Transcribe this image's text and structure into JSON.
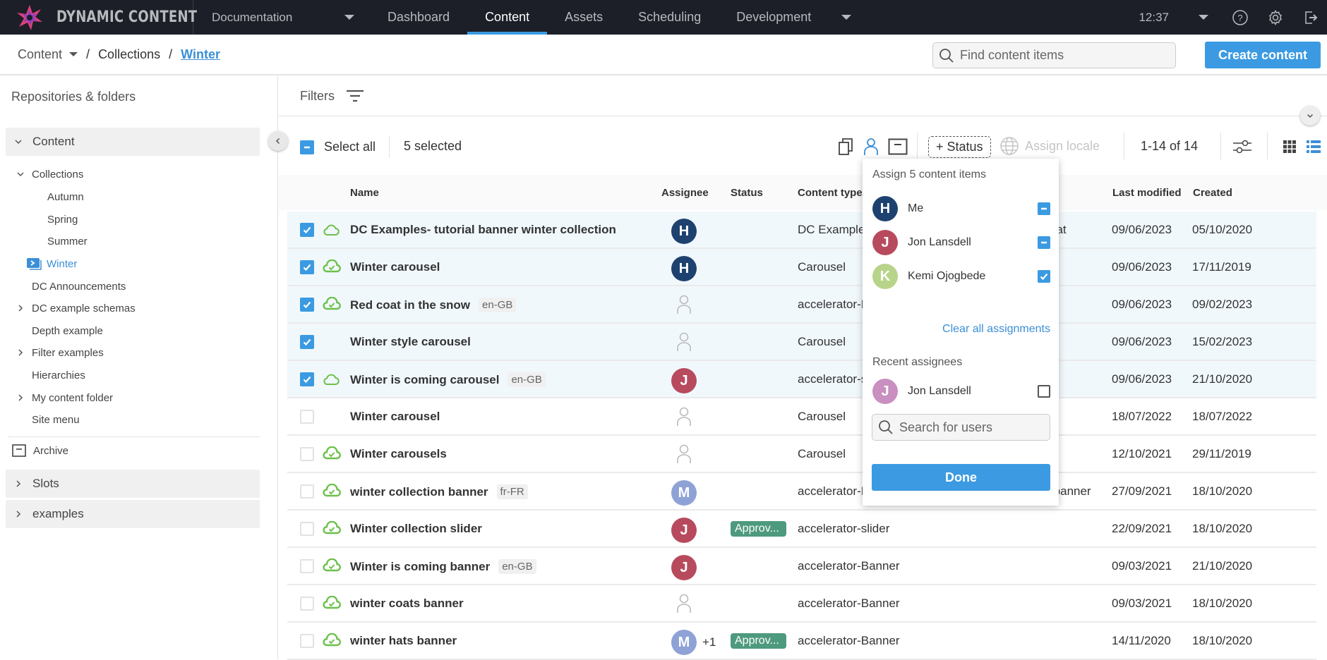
{
  "app": {
    "brand": "DYNAMIC CONTENT",
    "hub": "Documentation",
    "nav": [
      "Dashboard",
      "Content",
      "Assets",
      "Scheduling",
      "Development"
    ],
    "active_nav": "Content",
    "clock": "12:37"
  },
  "breadcrumb": {
    "root": "Content",
    "items": [
      "Collections"
    ],
    "current": "Winter"
  },
  "search": {
    "placeholder": "Find content items"
  },
  "create_button": "Create content",
  "sidebar": {
    "title": "Repositories & folders",
    "repo_content": "Content",
    "tree": [
      {
        "label": "Collections",
        "expanded": true
      },
      {
        "label": "Autumn"
      },
      {
        "label": "Spring"
      },
      {
        "label": "Summer"
      },
      {
        "label": "Winter",
        "active": true
      },
      {
        "label": "DC Announcements"
      },
      {
        "label": "DC example schemas",
        "expandable": true
      },
      {
        "label": "Depth example"
      },
      {
        "label": "Filter examples",
        "expandable": true
      },
      {
        "label": "Hierarchies"
      },
      {
        "label": "My content folder",
        "expandable": true
      },
      {
        "label": "Site menu"
      }
    ],
    "archive": "Archive",
    "repos": [
      "Slots",
      "examples"
    ]
  },
  "filters": {
    "label": "Filters"
  },
  "toolbar": {
    "select_all": "Select all",
    "selected": "5 selected",
    "status_button": "+ Status",
    "assign_locale": "Assign locale",
    "pager": "1-14 of 14"
  },
  "table": {
    "headers": {
      "name": "Name",
      "assignee": "Assignee",
      "status": "Status",
      "content_type": "Content type",
      "last_modified": "Last modified",
      "created": "Created"
    },
    "rows": [
      {
        "selected": true,
        "sync": "cloud",
        "name": "DC Examples- tutorial banner winter collection",
        "locale": "",
        "assignee": {
          "initial": "H",
          "color": "#1d426f"
        },
        "extra": "",
        "status": "",
        "content_type": "DC Examples",
        "content_type_tail": "nat",
        "modified": "09/06/2023",
        "created": "05/10/2020"
      },
      {
        "selected": true,
        "sync": "cloud-check",
        "name": "Winter carousel",
        "locale": "",
        "assignee": {
          "initial": "H",
          "color": "#1d426f"
        },
        "extra": "",
        "status": "",
        "content_type": "Carousel",
        "content_type_tail": "",
        "modified": "09/06/2023",
        "created": "17/11/2019"
      },
      {
        "selected": true,
        "sync": "cloud-check",
        "name": "Red coat in the snow",
        "locale": "en-GB",
        "assignee": null,
        "extra": "",
        "status": "",
        "content_type": "accelerator-B",
        "content_type_tail": "",
        "modified": "09/06/2023",
        "created": "09/02/2023"
      },
      {
        "selected": true,
        "sync": "",
        "name": "Winter style carousel",
        "locale": "",
        "assignee": null,
        "extra": "",
        "status": "",
        "content_type": "Carousel",
        "content_type_tail": "",
        "modified": "09/06/2023",
        "created": "15/02/2023"
      },
      {
        "selected": true,
        "sync": "cloud",
        "name": "Winter is coming carousel",
        "locale": "en-GB",
        "assignee": {
          "initial": "J",
          "color": "#b84a5e"
        },
        "extra": "",
        "status": "",
        "content_type": "accelerator-s",
        "content_type_tail": "",
        "modified": "09/06/2023",
        "created": "21/10/2020"
      },
      {
        "selected": false,
        "sync": "",
        "name": "Winter carousel",
        "locale": "",
        "assignee": null,
        "extra": "",
        "status": "",
        "content_type": "Carousel",
        "content_type_tail": "",
        "modified": "18/07/2022",
        "created": "18/07/2022"
      },
      {
        "selected": false,
        "sync": "cloud-check",
        "name": "Winter carousels",
        "locale": "",
        "assignee": null,
        "extra": "",
        "status": "",
        "content_type": "Carousel",
        "content_type_tail": "",
        "modified": "12/10/2021",
        "created": "29/11/2019"
      },
      {
        "selected": false,
        "sync": "cloud-check",
        "name": "winter collection banner",
        "locale": "fr-FR",
        "assignee": {
          "initial": "M",
          "color": "#8ea2d6"
        },
        "extra": "",
        "status": "",
        "content_type": "accelerator-B",
        "content_type_tail": "-banner",
        "modified": "27/09/2021",
        "created": "18/10/2020"
      },
      {
        "selected": false,
        "sync": "cloud-check",
        "name": "Winter collection slider",
        "locale": "",
        "assignee": {
          "initial": "J",
          "color": "#b84a5e"
        },
        "extra": "",
        "status": "Approv...",
        "content_type": "accelerator-slider",
        "content_type_tail": "",
        "modified": "22/09/2021",
        "created": "18/10/2020"
      },
      {
        "selected": false,
        "sync": "cloud-check",
        "name": "Winter is coming banner",
        "locale": "en-GB",
        "assignee": {
          "initial": "J",
          "color": "#b84a5e"
        },
        "extra": "",
        "status": "",
        "content_type": "accelerator-Banner",
        "content_type_tail": "",
        "modified": "09/03/2021",
        "created": "21/10/2020"
      },
      {
        "selected": false,
        "sync": "cloud-check",
        "name": "winter coats banner",
        "locale": "",
        "assignee": null,
        "extra": "",
        "status": "",
        "content_type": "accelerator-Banner",
        "content_type_tail": "",
        "modified": "09/03/2021",
        "created": "18/10/2020"
      },
      {
        "selected": false,
        "sync": "cloud-check",
        "name": "winter hats banner",
        "locale": "",
        "assignee": {
          "initial": "M",
          "color": "#8ea2d6"
        },
        "extra": "+1",
        "status": "Approv...",
        "content_type": "accelerator-Banner",
        "content_type_tail": "",
        "modified": "14/11/2020",
        "created": "18/10/2020"
      }
    ]
  },
  "assign_popover": {
    "title": "Assign 5 content items",
    "users": [
      {
        "initial": "H",
        "name": "Me",
        "color": "#1d426f",
        "state": "partial"
      },
      {
        "initial": "J",
        "name": "Jon Lansdell",
        "color": "#b84a5e",
        "state": "partial"
      },
      {
        "initial": "K",
        "name": "Kemi Ojogbede",
        "color": "#b8d48a",
        "state": "checked"
      }
    ],
    "clear_all": "Clear all assignments",
    "recent_title": "Recent assignees",
    "recent": [
      {
        "initial": "J",
        "name": "Jon Lansdell",
        "color": "#c88fc0",
        "state": "empty"
      }
    ],
    "search_placeholder": "Search for users",
    "done": "Done"
  },
  "colors": {
    "accent": "#3b9ae1",
    "topbar": "#1c1f28",
    "sync_green": "#6cc04a",
    "approved": "#4e9a7e"
  }
}
